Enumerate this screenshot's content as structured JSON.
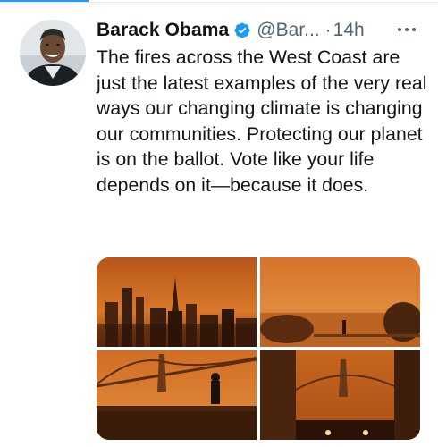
{
  "author": {
    "name": "Barack Obama",
    "handle": "@Bar...",
    "separator": "·",
    "time": "14h",
    "verified": true,
    "avatar_icon": "profile-photo"
  },
  "tweet": {
    "text": "The fires across the West Coast are just the latest examples of the very real ways our changing climate is changing our communities. Protecting our planet is on the ballot. Vote like your life depends on it—because it does."
  },
  "media": {
    "count": 4,
    "photos": [
      "city-skyline-orange-sky",
      "waterfront-orange-haze",
      "bay-bridge-person-standing",
      "street-bay-bridge-orange"
    ]
  },
  "colors": {
    "accent": "#1d9bf0",
    "text": "#0f1419",
    "muted": "#536471",
    "sky_orange": "#d46f1f"
  },
  "icons": {
    "verified": "verified-badge-icon",
    "more": "more-options-icon"
  }
}
